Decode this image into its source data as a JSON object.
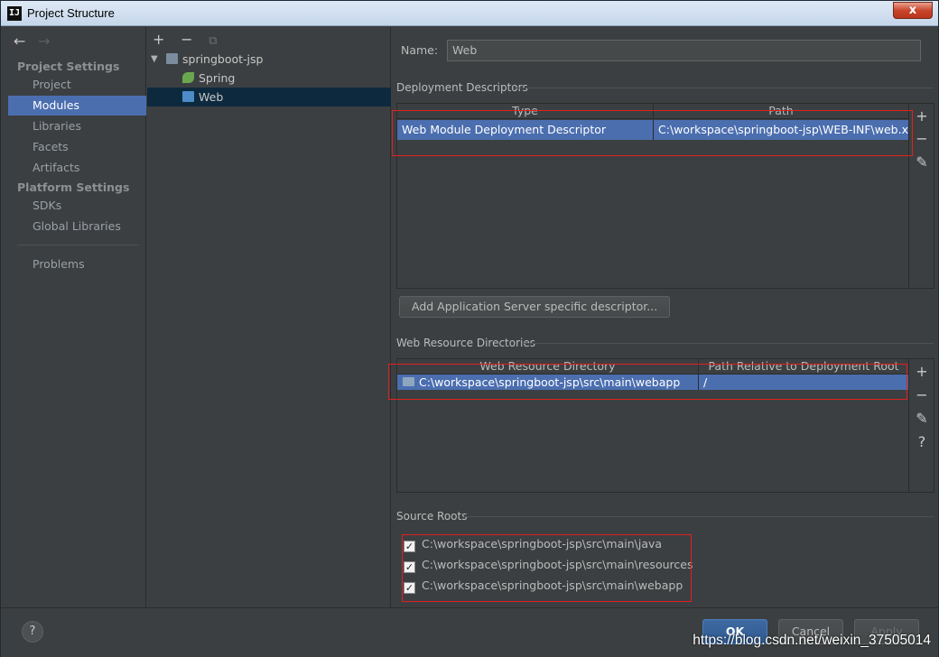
{
  "window": {
    "title": "Project Structure",
    "app_icon_text": "IJ",
    "close_label": "x"
  },
  "nav": {
    "back_icon": "←",
    "forward_icon": "→",
    "project_settings_header": "Project Settings",
    "project_settings": [
      "Project",
      "Modules",
      "Libraries",
      "Facets",
      "Artifacts"
    ],
    "platform_settings_header": "Platform Settings",
    "platform_settings": [
      "SDKs",
      "Global Libraries"
    ],
    "problems": "Problems",
    "selected": "Modules"
  },
  "tree": {
    "toolbar": {
      "add": "+",
      "remove": "−",
      "copy": "⧉"
    },
    "root": "springboot-jsp",
    "children": [
      "Spring",
      "Web"
    ],
    "selected": "Web"
  },
  "content": {
    "name_label": "Name:",
    "name_value": "Web",
    "deployment": {
      "title": "Deployment Descriptors",
      "headers": [
        "Type",
        "Path"
      ],
      "rows": [
        [
          "Web Module Deployment Descriptor",
          "C:\\workspace\\springboot-jsp\\WEB-INF\\web.xml"
        ]
      ],
      "add_button": "Add Application Server specific descriptor..."
    },
    "web_resources": {
      "title": "Web Resource Directories",
      "headers": [
        "Web Resource Directory",
        "Path Relative to Deployment Root"
      ],
      "rows": [
        [
          "C:\\workspace\\springboot-jsp\\src\\main\\webapp",
          "/"
        ]
      ]
    },
    "source_roots": {
      "title": "Source Roots",
      "items": [
        "C:\\workspace\\springboot-jsp\\src\\main\\java",
        "C:\\workspace\\springboot-jsp\\src\\main\\resources",
        "C:\\workspace\\springboot-jsp\\src\\main\\webapp"
      ]
    },
    "side_tools": {
      "add": "+",
      "remove": "−",
      "edit": "✎",
      "help": "?"
    }
  },
  "footer": {
    "help": "?",
    "ok": "OK",
    "cancel": "Cancel",
    "apply": "Apply",
    "watermark": "https://blog.csdn.net/weixin_37505014"
  }
}
